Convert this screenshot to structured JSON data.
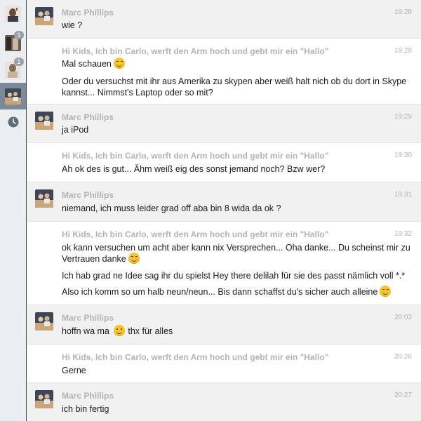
{
  "sidebar": {
    "items": [
      {
        "name": "contact-1",
        "badge": "",
        "active": false
      },
      {
        "name": "contact-2",
        "badge": "1",
        "active": false
      },
      {
        "name": "contact-3",
        "badge": "1",
        "active": false
      },
      {
        "name": "contact-4",
        "badge": "",
        "active": true
      }
    ],
    "history_icon": "clock-icon"
  },
  "messages": [
    {
      "author": "Marc Phillips",
      "time": "19:28",
      "lines": [
        "wie ?"
      ]
    },
    {
      "author": "Hi Kids, Ich bin Carlo, werft den Arm hoch und gebt mir ein \"Hallo\"",
      "time": "19:28",
      "lines": [
        "Mal schauen",
        "Oder du versuchst mit ihr aus Amerika zu skypen aber weiß halt nich ob du dort in Skype",
        "kannst... Nimmst's Laptop oder so mit?"
      ]
    },
    {
      "author": "Marc Phillips",
      "time": "19:29",
      "lines": [
        "ja iPod"
      ]
    },
    {
      "author": "Hi Kids, Ich bin Carlo, werft den Arm hoch und gebt mir ein \"Hallo\"",
      "time": "19:30",
      "lines": [
        "Ah ok des is gut... Ähm weiß eig des sonst jemand noch? Bzw wer?"
      ]
    },
    {
      "author": "Marc Phillips",
      "time": "19:31",
      "lines": [
        "niemand, ich muss leider grad off aba bin 8 wida da ok ?"
      ]
    },
    {
      "author": "Hi Kids, Ich bin Carlo, werft den Arm hoch und gebt mir ein \"Hallo\"",
      "time": "19:32",
      "lines": [
        "ok kann versuchen um acht aber kann nix Versprechen... Oha danke... Du scheinst mir zu",
        "Vertrauen danke",
        "Ich hab grad ne Idee sag ihr du spielst Hey there delilah für sie des passt nämlich voll *.*",
        "Also ich komm so um halb neun/neun... Bis dann schaffst du's sicher auch alleine"
      ]
    },
    {
      "author": "Marc Phillips",
      "time": "20:03",
      "lines": [
        "hoffn wa ma",
        "thx für alles"
      ]
    },
    {
      "author": "Hi Kids, Ich bin Carlo, werft den Arm hoch und gebt mir ein \"Hallo\"",
      "time": "20:26",
      "lines": [
        "Gerne"
      ]
    },
    {
      "author": "Marc Phillips",
      "time": "20:27",
      "lines": [
        "ich bin fertig"
      ]
    }
  ],
  "colors": {
    "sidebar_bg": "#eaeef1",
    "sidebar_active": "#7c8a97",
    "author": "#b3b3b3",
    "alt_row": "#f1f1f1"
  }
}
